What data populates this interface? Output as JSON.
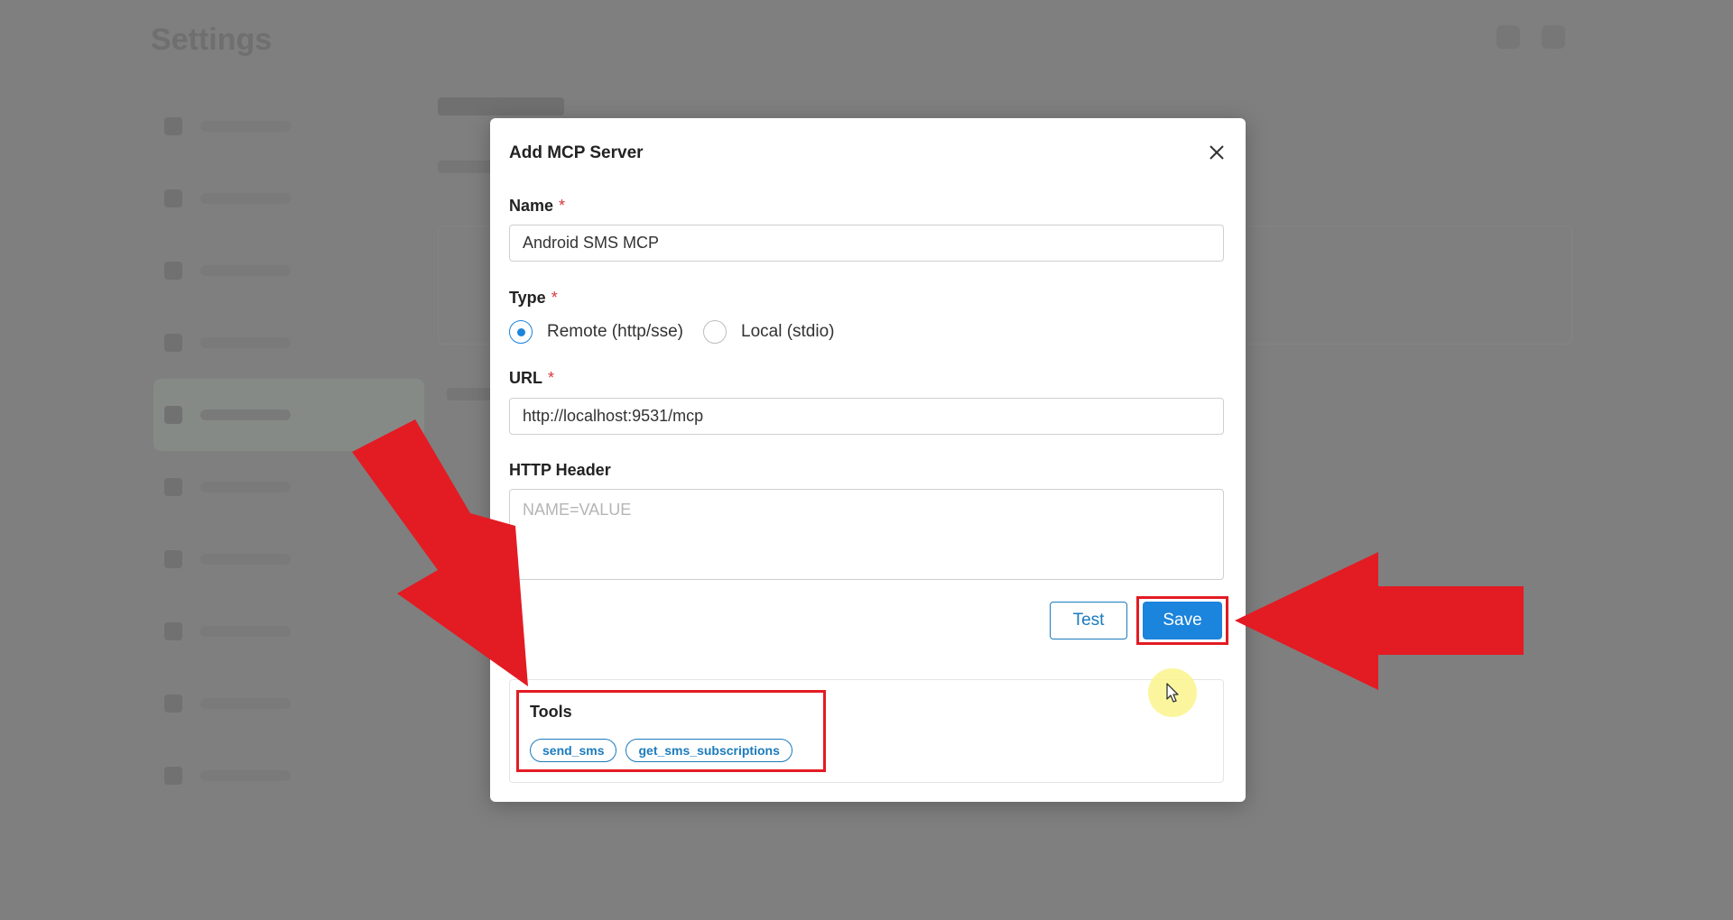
{
  "background": {
    "page_title": "Settings"
  },
  "modal": {
    "title": "Add MCP Server",
    "name_label": "Name",
    "name_value": "Android SMS MCP",
    "required_mark": "*",
    "type_label": "Type",
    "type_options": [
      "Remote (http/sse)",
      "Local (stdio)"
    ],
    "type_selected": "Remote (http/sse)",
    "url_label": "URL",
    "url_value": "http://localhost:9531/mcp",
    "header_label": "HTTP Header",
    "header_placeholder": "NAME=VALUE",
    "test_label": "Test",
    "save_label": "Save",
    "tools_title": "Tools",
    "tools": [
      "send_sms",
      "get_sms_subscriptions"
    ]
  },
  "colors": {
    "primary": "#1b84dc",
    "annotation_red": "#e31b23",
    "overlay": "#7f7f7f"
  },
  "icons": {
    "close": "close-icon",
    "cursor": "cursor-icon"
  }
}
